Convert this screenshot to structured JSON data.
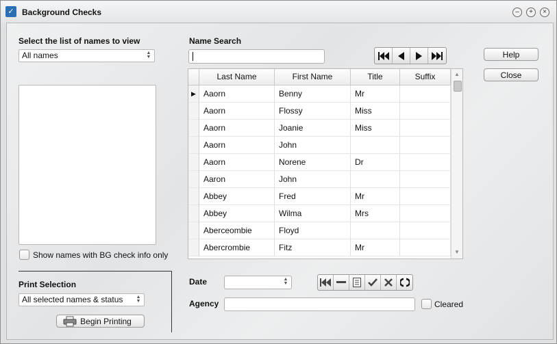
{
  "window": {
    "title": "Background Checks"
  },
  "left": {
    "list_label": "Select the list of names to view",
    "list_select": "All names",
    "bg_only_label": "Show names with BG check info only",
    "print_label": "Print Selection",
    "print_select": "All selected names & status",
    "begin_printing": "Begin Printing"
  },
  "search": {
    "label": "Name Search",
    "value": ""
  },
  "buttons": {
    "help": "Help",
    "close": "Close"
  },
  "grid": {
    "columns": [
      "Last Name",
      "First Name",
      "Title",
      "Suffix"
    ],
    "rows": [
      [
        "Aaorn",
        "Benny",
        "Mr",
        ""
      ],
      [
        "Aaorn",
        "Flossy",
        "Miss",
        ""
      ],
      [
        "Aaorn",
        "Joanie",
        "Miss",
        ""
      ],
      [
        "Aaorn",
        "John",
        "",
        ""
      ],
      [
        "Aaorn",
        "Norene",
        "Dr",
        ""
      ],
      [
        "Aaron",
        "John",
        "",
        ""
      ],
      [
        "Abbey",
        "Fred",
        "Mr",
        ""
      ],
      [
        "Abbey",
        "Wilma",
        "Mrs",
        ""
      ],
      [
        "Aberceombie",
        "Floyd",
        "",
        ""
      ],
      [
        "Abercrombie",
        "Fitz",
        "Mr",
        ""
      ]
    ],
    "selected_row": 0
  },
  "detail": {
    "date_label": "Date",
    "date_value": "",
    "agency_label": "Agency",
    "agency_value": "",
    "cleared_label": "Cleared"
  },
  "icons": {
    "navigator": [
      "first-record-icon",
      "previous-record-icon",
      "next-record-icon",
      "last-record-icon"
    ],
    "editor": [
      "first-icon",
      "delete-icon",
      "edit-icon",
      "save-check-icon",
      "cancel-x-icon",
      "refresh-icon"
    ]
  }
}
